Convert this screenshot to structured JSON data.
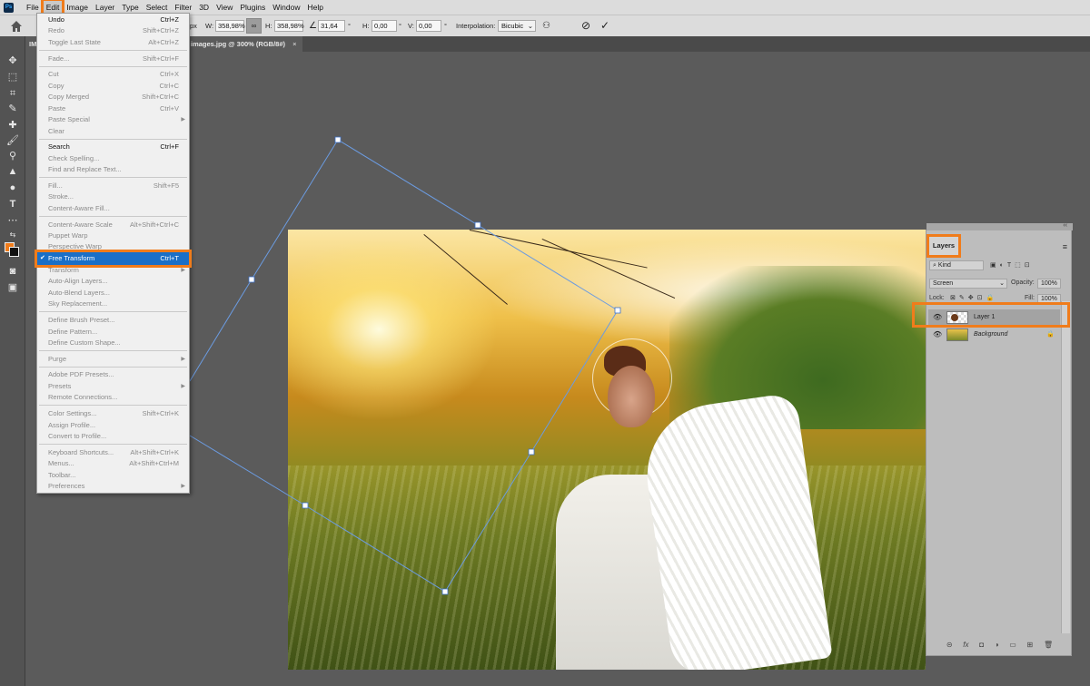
{
  "menubar": {
    "logo": "Ps",
    "items": [
      "File",
      "Edit",
      "Image",
      "Layer",
      "Type",
      "Select",
      "Filter",
      "3D",
      "View",
      "Plugins",
      "Window",
      "Help"
    ]
  },
  "options_bar": {
    "x_unit": "px",
    "w_label": "W:",
    "w_value": "358,98%",
    "link_icon": "∞",
    "h_label": "H:",
    "h_value": "358,98%",
    "angle_value": "31,64",
    "deg": "°",
    "hskew_label": "H:",
    "hskew_value": "0,00",
    "vskew_label": "V:",
    "vskew_value": "0,00",
    "interp_label": "Interpolation:",
    "interp_value": "Bicubic",
    "cancel_icon": "⊘",
    "commit_icon": "✓"
  },
  "tabs": [
    {
      "label": "IM"
    },
    {
      "label": "images.jpg @ 300% (RGB/8#)",
      "close": "×"
    }
  ],
  "edit_menu": {
    "items": [
      {
        "label": "Undo",
        "shortcut": "Ctrl+Z",
        "enabled": true
      },
      {
        "label": "Redo",
        "shortcut": "Shift+Ctrl+Z",
        "enabled": false
      },
      {
        "label": "Toggle Last State",
        "shortcut": "Alt+Ctrl+Z",
        "enabled": false
      },
      {
        "label": "Fade...",
        "shortcut": "Shift+Ctrl+F",
        "enabled": false
      },
      {
        "label": "Cut",
        "shortcut": "Ctrl+X",
        "enabled": false
      },
      {
        "label": "Copy",
        "shortcut": "Ctrl+C",
        "enabled": false
      },
      {
        "label": "Copy Merged",
        "shortcut": "Shift+Ctrl+C",
        "enabled": false
      },
      {
        "label": "Paste",
        "shortcut": "Ctrl+V",
        "enabled": false
      },
      {
        "label": "Paste Special",
        "shortcut": "",
        "enabled": false,
        "submenu": true
      },
      {
        "label": "Clear",
        "shortcut": "",
        "enabled": false
      },
      {
        "label": "Search",
        "shortcut": "Ctrl+F",
        "enabled": true
      },
      {
        "label": "Check Spelling...",
        "shortcut": "",
        "enabled": false
      },
      {
        "label": "Find and Replace Text...",
        "shortcut": "",
        "enabled": false
      },
      {
        "label": "Fill...",
        "shortcut": "Shift+F5",
        "enabled": false
      },
      {
        "label": "Stroke...",
        "shortcut": "",
        "enabled": false
      },
      {
        "label": "Content-Aware Fill...",
        "shortcut": "",
        "enabled": false
      },
      {
        "label": "Content-Aware Scale",
        "shortcut": "Alt+Shift+Ctrl+C",
        "enabled": false
      },
      {
        "label": "Puppet Warp",
        "shortcut": "",
        "enabled": false
      },
      {
        "label": "Perspective Warp",
        "shortcut": "",
        "enabled": false
      },
      {
        "label": "Free Transform",
        "shortcut": "Ctrl+T",
        "enabled": true,
        "checked": true,
        "highlighted": true
      },
      {
        "label": "Transform",
        "shortcut": "",
        "enabled": false,
        "submenu": true
      },
      {
        "label": "Auto-Align Layers...",
        "shortcut": "",
        "enabled": false
      },
      {
        "label": "Auto-Blend Layers...",
        "shortcut": "",
        "enabled": false
      },
      {
        "label": "Sky Replacement...",
        "shortcut": "",
        "enabled": false
      },
      {
        "label": "Define Brush Preset...",
        "shortcut": "",
        "enabled": false
      },
      {
        "label": "Define Pattern...",
        "shortcut": "",
        "enabled": false
      },
      {
        "label": "Define Custom Shape...",
        "shortcut": "",
        "enabled": false
      },
      {
        "label": "Purge",
        "shortcut": "",
        "enabled": false,
        "submenu": true
      },
      {
        "label": "Adobe PDF Presets...",
        "shortcut": "",
        "enabled": false
      },
      {
        "label": "Presets",
        "shortcut": "",
        "enabled": false,
        "submenu": true
      },
      {
        "label": "Remote Connections...",
        "shortcut": "",
        "enabled": false
      },
      {
        "label": "Color Settings...",
        "shortcut": "Shift+Ctrl+K",
        "enabled": false
      },
      {
        "label": "Assign Profile...",
        "shortcut": "",
        "enabled": false
      },
      {
        "label": "Convert to Profile...",
        "shortcut": "",
        "enabled": false
      },
      {
        "label": "Keyboard Shortcuts...",
        "shortcut": "Alt+Shift+Ctrl+K",
        "enabled": false
      },
      {
        "label": "Menus...",
        "shortcut": "Alt+Shift+Ctrl+M",
        "enabled": false
      },
      {
        "label": "Toolbar...",
        "shortcut": "",
        "enabled": false
      },
      {
        "label": "Preferences",
        "shortcut": "",
        "enabled": false,
        "submenu": true
      }
    ],
    "submenu_arrow": "▶",
    "check_mark": "✔"
  },
  "layers_panel": {
    "tab_label": "Layers",
    "kind_filter": "Kind",
    "blend_mode": "Screen",
    "opacity_label": "Opacity:",
    "opacity_value": "100%",
    "lock_label": "Lock:",
    "fill_label": "Fill:",
    "fill_value": "100%",
    "layers": [
      {
        "name": "Layer 1",
        "selected": true
      },
      {
        "name": "Background",
        "selected": false,
        "locked": true
      }
    ],
    "footer_icons": [
      "link-icon",
      "fx-icon",
      "mask-icon",
      "adjustment-icon",
      "group-icon",
      "new-layer-icon",
      "trash-icon"
    ],
    "footer_glyphs": [
      "⊝",
      "fx",
      "◘",
      "◑",
      "▭",
      "⊞",
      "🗑"
    ]
  },
  "colors": {
    "accent_highlight": "#f07c1b",
    "menu_selection": "#1a6fc7",
    "foreground_swatch": "#f07c1b",
    "background_swatch": "#111111"
  }
}
